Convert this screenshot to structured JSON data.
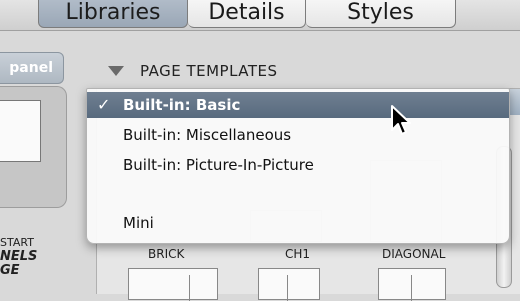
{
  "tabs": [
    {
      "label": "Libraries",
      "selected": true
    },
    {
      "label": "Details",
      "selected": false
    },
    {
      "label": "Styles",
      "selected": false
    }
  ],
  "left_column": {
    "panel_button": "panel",
    "caption_line1": "START",
    "caption_line2": "NELS",
    "caption_line3": "GE"
  },
  "section": {
    "title": "PAGE TEMPLATES",
    "expanded": true
  },
  "menu": {
    "checkmark": "✓",
    "items": [
      {
        "label": "Built-in: Basic",
        "selected": true,
        "checked": true
      },
      {
        "label": "Built-in: Miscellaneous",
        "selected": false,
        "checked": false
      },
      {
        "label": "Built-in: Picture-In-Picture",
        "selected": false,
        "checked": false
      },
      {
        "label": "Mini",
        "selected": false,
        "checked": false
      }
    ]
  },
  "templates": [
    {
      "label": "BRICK"
    },
    {
      "label": "CH1"
    },
    {
      "label": "DIAGONAL"
    }
  ],
  "colors": {
    "selection": "#5f7084",
    "tab_selected": "#a3afbd"
  },
  "icons": [
    "disclosure-triangle-icon",
    "arrow-cursor-icon",
    "checkmark-icon"
  ]
}
